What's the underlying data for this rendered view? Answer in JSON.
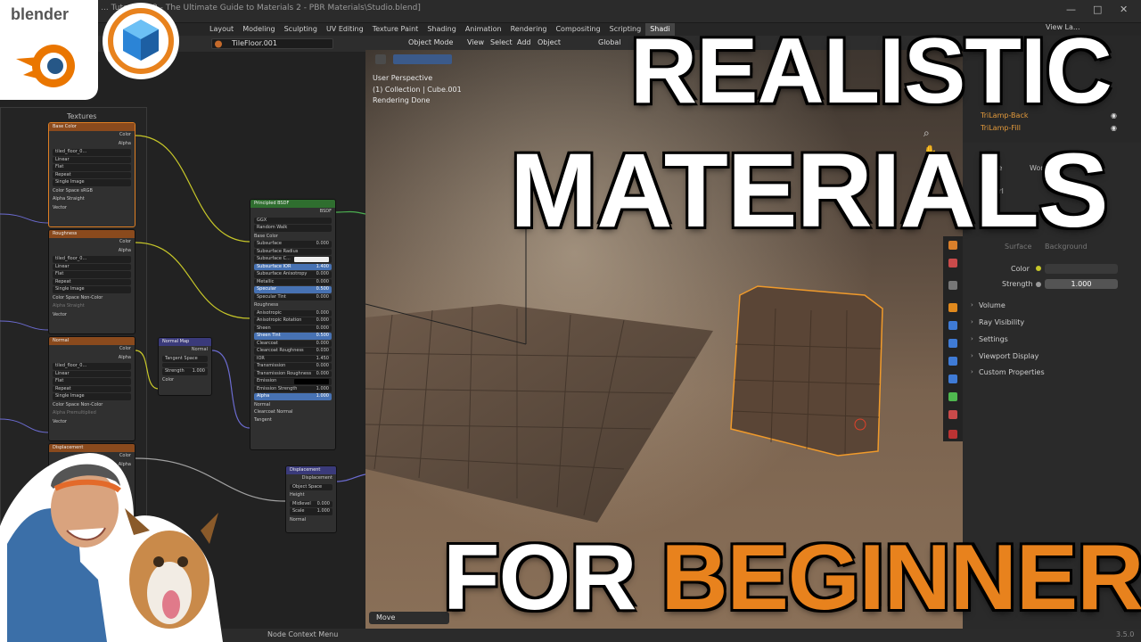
{
  "window": {
    "title": "Essential ... Tutorials\\32 - The Ultimate Guide to Materials 2 - PBR Materials\\Studio.blend]",
    "controls": [
      "—",
      "□",
      "✕"
    ]
  },
  "workspaces": [
    "Layout",
    "Modeling",
    "Sculpting",
    "UV Editing",
    "Texture Paint",
    "Shading",
    "Animation",
    "Rendering",
    "Compositing",
    "Scripting",
    "Shadi"
  ],
  "active_workspace": "Shadi",
  "node_editor": {
    "material_name": "TileFloor.001",
    "frame_label": "Textures",
    "base_color_node": {
      "title": "Base Color",
      "outputs": [
        "Color",
        "Alpha"
      ],
      "image": "tiled_floor_0...",
      "users": "2",
      "settings": [
        "Linear",
        "Flat",
        "Repeat",
        "Single Image"
      ],
      "color_space_label": "Color Space",
      "color_space": "sRGB",
      "alpha_label": "Alpha",
      "alpha": "Straight",
      "input": "Vector"
    },
    "roughness_node": {
      "title": "Roughness",
      "outputs": [
        "Color",
        "Alpha"
      ],
      "image": "tiled_floor_0...",
      "users": "2",
      "settings": [
        "Linear",
        "Flat",
        "Repeat",
        "Single Image"
      ],
      "color_space_label": "Color Space",
      "color_space": "Non-Color",
      "alpha_label": "Alpha",
      "alpha": "Straight",
      "input": "Vector"
    },
    "normal_tex_node": {
      "title": "Normal",
      "outputs": [
        "Color",
        "Alpha"
      ],
      "image": "tiled_floor_0...",
      "users": "2",
      "settings": [
        "Linear",
        "Flat",
        "Repeat",
        "Single Image"
      ],
      "color_space_label": "Color Space",
      "color_space": "Non-Color",
      "alpha_label": "Alpha",
      "alpha": "Premultiplied",
      "input": "Vector"
    },
    "displacement_tex_node": {
      "title": "Displacement",
      "outputs": [
        "Color",
        "Alpha"
      ]
    },
    "normal_map_node": {
      "title": "Normal Map",
      "output": "Normal",
      "space": "Tangent Space",
      "strength_label": "Strength",
      "strength": "1.000",
      "input": "Color"
    },
    "principled_node": {
      "title": "Principled BSDF",
      "output": "BSDF",
      "distribution": "GGX",
      "subsurface_method": "Random Walk",
      "rows": [
        {
          "label": "Base Color",
          "value": "",
          "kind": "socket"
        },
        {
          "label": "Subsurface",
          "value": "0.000",
          "kind": "field"
        },
        {
          "label": "Subsurface Radius",
          "value": "",
          "kind": "field"
        },
        {
          "label": "Subsurface C...",
          "value": "",
          "kind": "color"
        },
        {
          "label": "Subsurface IOR",
          "value": "1.400",
          "kind": "blue"
        },
        {
          "label": "Subsurface Anisotropy",
          "value": "0.000",
          "kind": "field"
        },
        {
          "label": "Metallic",
          "value": "0.000",
          "kind": "field"
        },
        {
          "label": "Specular",
          "value": "0.500",
          "kind": "blue"
        },
        {
          "label": "Specular Tint",
          "value": "0.000",
          "kind": "field"
        },
        {
          "label": "Roughness",
          "value": "",
          "kind": "socket"
        },
        {
          "label": "Anisotropic",
          "value": "0.000",
          "kind": "field"
        },
        {
          "label": "Anisotropic Rotation",
          "value": "0.000",
          "kind": "field"
        },
        {
          "label": "Sheen",
          "value": "0.000",
          "kind": "field"
        },
        {
          "label": "Sheen Tint",
          "value": "0.500",
          "kind": "blue"
        },
        {
          "label": "Clearcoat",
          "value": "0.000",
          "kind": "field"
        },
        {
          "label": "Clearcoat Roughness",
          "value": "0.030",
          "kind": "field"
        },
        {
          "label": "IOR",
          "value": "1.450",
          "kind": "field"
        },
        {
          "label": "Transmission",
          "value": "0.000",
          "kind": "field"
        },
        {
          "label": "Transmission Roughness",
          "value": "0.000",
          "kind": "field"
        },
        {
          "label": "Emission",
          "value": "",
          "kind": "dark"
        },
        {
          "label": "Emission Strength",
          "value": "1.000",
          "kind": "field"
        },
        {
          "label": "Alpha",
          "value": "1.000",
          "kind": "blue"
        },
        {
          "label": "Normal",
          "value": "",
          "kind": "socket"
        },
        {
          "label": "Clearcoat Normal",
          "value": "",
          "kind": "socket"
        },
        {
          "label": "Tangent",
          "value": "",
          "kind": "socket"
        }
      ]
    },
    "displacement_node": {
      "title": "Displacement",
      "output": "Displacement",
      "space": "Object Space",
      "height_label": "Height",
      "midlevel_label": "Midlevel",
      "midlevel": "0.000",
      "scale_label": "Scale",
      "scale": "1.000",
      "normal_label": "Normal"
    }
  },
  "viewport": {
    "mode": "Object Mode",
    "menus": [
      "View",
      "Select",
      "Add",
      "Object"
    ],
    "orientation": "Global",
    "info": [
      "User Perspective",
      "(1) Collection | Cube.001",
      "Rendering Done"
    ],
    "operator_panel": "Move"
  },
  "outliner": {
    "rows": [
      "TriLamp-Back",
      "TriLamp-Fill"
    ],
    "view_layer": "View La..."
  },
  "properties": {
    "tabs": [
      "Scene",
      "World"
    ],
    "world_label": "Worl",
    "surface_label": "Surface",
    "background_label": "Background",
    "color_label": "Color",
    "strength_label": "Strength",
    "strength": "1.000",
    "panels": [
      "Volume",
      "Ray Visibility",
      "Settings",
      "Viewport Display",
      "Custom Properties"
    ]
  },
  "status": {
    "text": "Node Context Menu",
    "version": "3.5.0"
  },
  "headline": {
    "line1": "REALISTIC",
    "line2": "MATERIALS",
    "line3_a": "FOR",
    "line3_b": "BEGINNERS!"
  },
  "logos": {
    "blender_text": "blender"
  },
  "colors": {
    "accent": "#e8821d",
    "selection": "#e07f23",
    "blue_field": "#4772b3"
  }
}
